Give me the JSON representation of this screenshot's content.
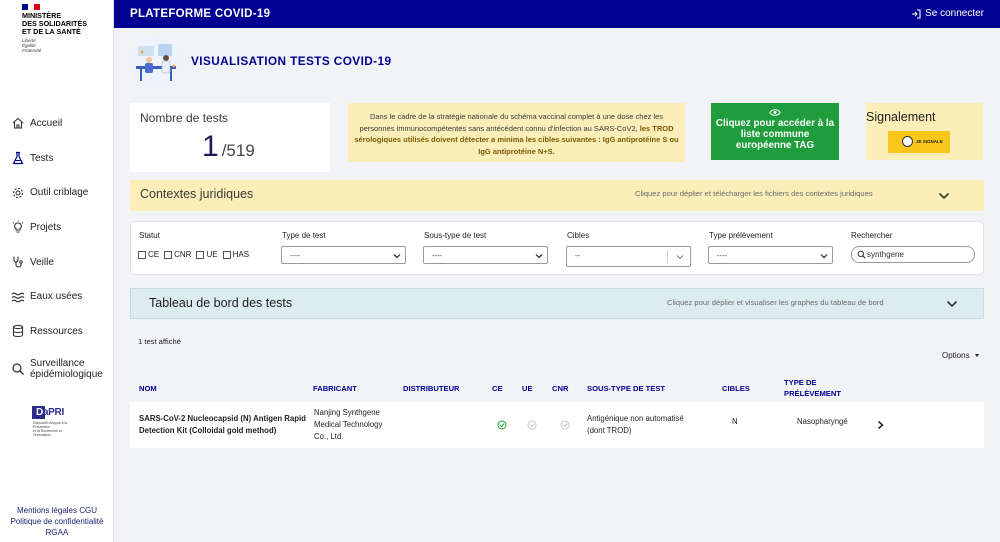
{
  "sidebar": {
    "logo": {
      "title": "MINISTÈRE\nDES SOLIDARITÉS\nET DE LA SANTÉ",
      "motto": "Liberté\nÉgalité\nFraternité"
    },
    "items": [
      {
        "label": "Accueil",
        "icon": "home-icon"
      },
      {
        "label": "Tests",
        "icon": "flask-icon"
      },
      {
        "label": "Outil criblage",
        "icon": "gear-icon"
      },
      {
        "label": "Projets",
        "icon": "lightbulb-icon"
      },
      {
        "label": "Veille",
        "icon": "stethoscope-icon"
      },
      {
        "label": "Eaux usées",
        "icon": "waves-icon"
      },
      {
        "label": "Ressources",
        "icon": "database-icon"
      },
      {
        "label": "Surveillance épidémiologique",
        "icon": "search-icon"
      }
    ],
    "dapri": {
      "name": "DaPRI",
      "subtitle": "Dispositif d'Appui à la Prévention\net la Recherche et l'Innovation"
    },
    "footer": [
      "Mentions légales CGU",
      "Politique de confidentialité",
      "RGAA"
    ]
  },
  "header": {
    "title": "PLATEFORME COVID-19",
    "connect": "Se connecter"
  },
  "page": {
    "title": "VISUALISATION TESTS COVID-19"
  },
  "stats": {
    "count_label": "Nombre de tests",
    "current": "1",
    "total": "/519",
    "info_text": "Dans le cadre de la stratégie nationale du schéma vaccinal complet à une dose chez les personnes immunocompétentes sans antécédent connu d'infection au SARS-CoV2, ",
    "info_highlight": "les TROD sérologiques utilisés doivent détecter a minima les cibles suivantes : IgG antiprotéine S ou IgG antiprotéine N+S.",
    "tag_button": "Cliquez pour accéder à la liste commune européenne TAG",
    "signal_title": "Signalement",
    "signal_button": "JE SIGNALE"
  },
  "contextes": {
    "title": "Contextes juridiques",
    "hint": "Cliquez pour déplier et télécharger les fichiers des contextes juridiques"
  },
  "filters": {
    "statut_label": "Statut",
    "checkboxes": [
      "CE",
      "CNR",
      "UE",
      "HAS"
    ],
    "type_label": "Type de test",
    "type_value": "----",
    "soustype_label": "Sous-type de test",
    "soustype_value": "----",
    "cibles_label": "Cibles",
    "cibles_value": "--",
    "prelevement_label": "Type prélèvement",
    "prelevement_value": "----",
    "search_label": "Rechercher",
    "search_value": "synthgene"
  },
  "dashboard": {
    "title": "Tableau de bord des tests",
    "hint": "Cliquez pour déplier et visualiser les graphes du tableau de bord"
  },
  "results": {
    "shown": "1 test affiché",
    "options": "Options"
  },
  "table": {
    "headers": {
      "nom": "NOM",
      "fabricant": "FABRICANT",
      "distributeur": "DISTRIBUTEUR",
      "ce": "CE",
      "ue": "UE",
      "cnr": "CNR",
      "soustype": "SOUS-TYPE DE TEST",
      "cibles": "CIBLES",
      "prelevement": "TYPE DE PRÉLÈVEMENT"
    },
    "rows": [
      {
        "nom": "SARS-CoV-2 Nucleocapsid (N) Antigen Rapid Detection Kit (Colloidal gold method)",
        "fabricant": "Nanjing Synthgene Medical Technology Co., Ltd.",
        "distributeur": "",
        "ce": true,
        "ue": false,
        "cnr": false,
        "soustype": "Antigénique non automatisé (dont TROD)",
        "cibles": "N",
        "prelevement": "Nasopharyngé"
      }
    ]
  },
  "colors": {
    "primary": "#000091",
    "accent_green": "#1f9d3c",
    "warning_bg": "#fbeeb9",
    "info_bg": "#dcecf0",
    "check_green": "#1f9d3c"
  }
}
